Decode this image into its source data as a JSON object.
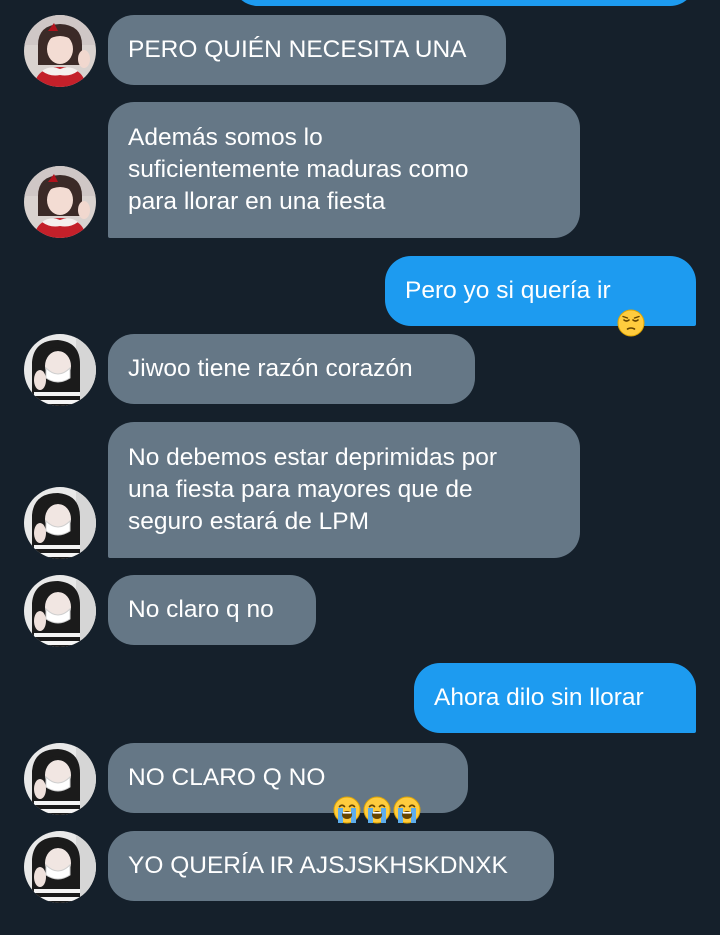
{
  "messages": [
    {
      "id": "m1",
      "side": "in",
      "text": "PERO QUIÉN NECESITA UNA",
      "sender": "user-a"
    },
    {
      "id": "m2",
      "side": "in",
      "text": "Además somos lo\nsuficientemente maduras como\npara llorar en una fiesta",
      "sender": "user-a"
    },
    {
      "id": "m3",
      "side": "out",
      "text": "Pero yo si quería ir",
      "emoji": [
        "pensive-face-emoji"
      ]
    },
    {
      "id": "m4",
      "side": "in",
      "text": "Jiwoo tiene razón corazón",
      "sender": "user-b"
    },
    {
      "id": "m5",
      "side": "in",
      "text": "No debemos estar deprimidas por\nuna fiesta para mayores que de\nseguro estará de LPM",
      "sender": "user-b"
    },
    {
      "id": "m6",
      "side": "in",
      "text": "No claro q no",
      "sender": "user-b"
    },
    {
      "id": "m7",
      "side": "out",
      "text": "Ahora dilo sin llorar"
    },
    {
      "id": "m8",
      "side": "in",
      "text": "NO CLARO Q NO",
      "emoji": [
        "loudly-crying-face-emoji",
        "loudly-crying-face-emoji",
        "loudly-crying-face-emoji"
      ],
      "sender": "user-b"
    },
    {
      "id": "m9",
      "side": "in",
      "text": "YO QUERÍA IR AJSJSKHSKDNXK",
      "sender": "user-b"
    }
  ],
  "colors": {
    "background": "#15202b",
    "incoming_bubble": "#657786",
    "outgoing_bubble": "#1d9bf0",
    "text": "#ffffff"
  }
}
